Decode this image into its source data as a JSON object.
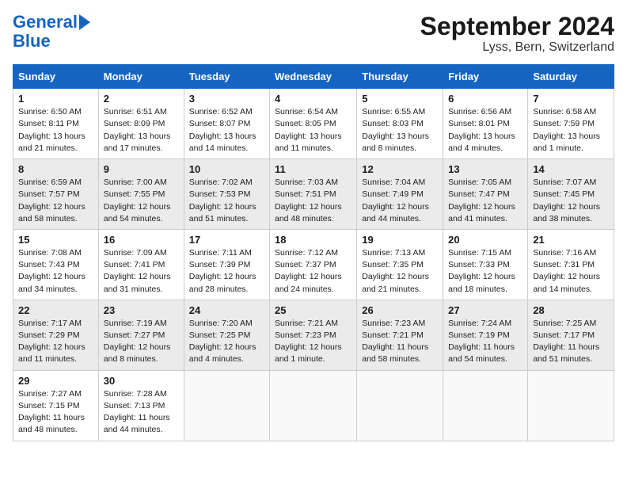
{
  "header": {
    "logo_line1": "General",
    "logo_line2": "Blue",
    "title": "September 2024",
    "subtitle": "Lyss, Bern, Switzerland"
  },
  "calendar": {
    "days_of_week": [
      "Sunday",
      "Monday",
      "Tuesday",
      "Wednesday",
      "Thursday",
      "Friday",
      "Saturday"
    ],
    "weeks": [
      [
        {
          "day": "1",
          "info": "Sunrise: 6:50 AM\nSunset: 8:11 PM\nDaylight: 13 hours\nand 21 minutes."
        },
        {
          "day": "2",
          "info": "Sunrise: 6:51 AM\nSunset: 8:09 PM\nDaylight: 13 hours\nand 17 minutes."
        },
        {
          "day": "3",
          "info": "Sunrise: 6:52 AM\nSunset: 8:07 PM\nDaylight: 13 hours\nand 14 minutes."
        },
        {
          "day": "4",
          "info": "Sunrise: 6:54 AM\nSunset: 8:05 PM\nDaylight: 13 hours\nand 11 minutes."
        },
        {
          "day": "5",
          "info": "Sunrise: 6:55 AM\nSunset: 8:03 PM\nDaylight: 13 hours\nand 8 minutes."
        },
        {
          "day": "6",
          "info": "Sunrise: 6:56 AM\nSunset: 8:01 PM\nDaylight: 13 hours\nand 4 minutes."
        },
        {
          "day": "7",
          "info": "Sunrise: 6:58 AM\nSunset: 7:59 PM\nDaylight: 13 hours\nand 1 minute."
        }
      ],
      [
        {
          "day": "8",
          "info": "Sunrise: 6:59 AM\nSunset: 7:57 PM\nDaylight: 12 hours\nand 58 minutes."
        },
        {
          "day": "9",
          "info": "Sunrise: 7:00 AM\nSunset: 7:55 PM\nDaylight: 12 hours\nand 54 minutes."
        },
        {
          "day": "10",
          "info": "Sunrise: 7:02 AM\nSunset: 7:53 PM\nDaylight: 12 hours\nand 51 minutes."
        },
        {
          "day": "11",
          "info": "Sunrise: 7:03 AM\nSunset: 7:51 PM\nDaylight: 12 hours\nand 48 minutes."
        },
        {
          "day": "12",
          "info": "Sunrise: 7:04 AM\nSunset: 7:49 PM\nDaylight: 12 hours\nand 44 minutes."
        },
        {
          "day": "13",
          "info": "Sunrise: 7:05 AM\nSunset: 7:47 PM\nDaylight: 12 hours\nand 41 minutes."
        },
        {
          "day": "14",
          "info": "Sunrise: 7:07 AM\nSunset: 7:45 PM\nDaylight: 12 hours\nand 38 minutes."
        }
      ],
      [
        {
          "day": "15",
          "info": "Sunrise: 7:08 AM\nSunset: 7:43 PM\nDaylight: 12 hours\nand 34 minutes."
        },
        {
          "day": "16",
          "info": "Sunrise: 7:09 AM\nSunset: 7:41 PM\nDaylight: 12 hours\nand 31 minutes."
        },
        {
          "day": "17",
          "info": "Sunrise: 7:11 AM\nSunset: 7:39 PM\nDaylight: 12 hours\nand 28 minutes."
        },
        {
          "day": "18",
          "info": "Sunrise: 7:12 AM\nSunset: 7:37 PM\nDaylight: 12 hours\nand 24 minutes."
        },
        {
          "day": "19",
          "info": "Sunrise: 7:13 AM\nSunset: 7:35 PM\nDaylight: 12 hours\nand 21 minutes."
        },
        {
          "day": "20",
          "info": "Sunrise: 7:15 AM\nSunset: 7:33 PM\nDaylight: 12 hours\nand 18 minutes."
        },
        {
          "day": "21",
          "info": "Sunrise: 7:16 AM\nSunset: 7:31 PM\nDaylight: 12 hours\nand 14 minutes."
        }
      ],
      [
        {
          "day": "22",
          "info": "Sunrise: 7:17 AM\nSunset: 7:29 PM\nDaylight: 12 hours\nand 11 minutes."
        },
        {
          "day": "23",
          "info": "Sunrise: 7:19 AM\nSunset: 7:27 PM\nDaylight: 12 hours\nand 8 minutes."
        },
        {
          "day": "24",
          "info": "Sunrise: 7:20 AM\nSunset: 7:25 PM\nDaylight: 12 hours\nand 4 minutes."
        },
        {
          "day": "25",
          "info": "Sunrise: 7:21 AM\nSunset: 7:23 PM\nDaylight: 12 hours\nand 1 minute."
        },
        {
          "day": "26",
          "info": "Sunrise: 7:23 AM\nSunset: 7:21 PM\nDaylight: 11 hours\nand 58 minutes."
        },
        {
          "day": "27",
          "info": "Sunrise: 7:24 AM\nSunset: 7:19 PM\nDaylight: 11 hours\nand 54 minutes."
        },
        {
          "day": "28",
          "info": "Sunrise: 7:25 AM\nSunset: 7:17 PM\nDaylight: 11 hours\nand 51 minutes."
        }
      ],
      [
        {
          "day": "29",
          "info": "Sunrise: 7:27 AM\nSunset: 7:15 PM\nDaylight: 11 hours\nand 48 minutes."
        },
        {
          "day": "30",
          "info": "Sunrise: 7:28 AM\nSunset: 7:13 PM\nDaylight: 11 hours\nand 44 minutes."
        },
        {
          "day": "",
          "info": ""
        },
        {
          "day": "",
          "info": ""
        },
        {
          "day": "",
          "info": ""
        },
        {
          "day": "",
          "info": ""
        },
        {
          "day": "",
          "info": ""
        }
      ]
    ]
  }
}
